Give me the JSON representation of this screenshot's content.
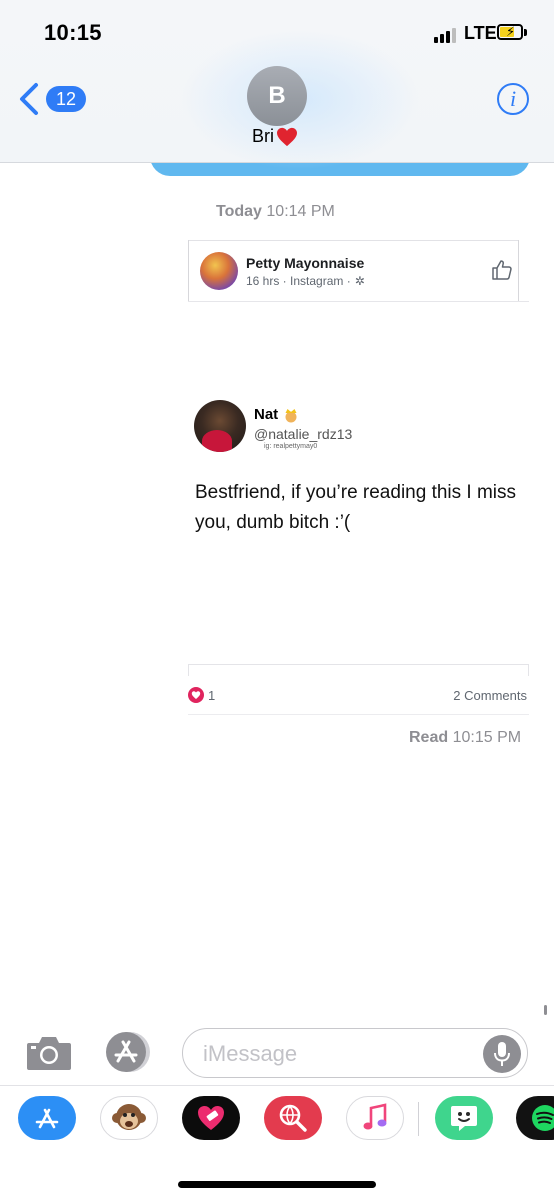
{
  "status_bar": {
    "time": "10:15",
    "network": "LTE"
  },
  "header": {
    "back_badge": "12",
    "avatar_initial": "B",
    "contact_name": "Bri"
  },
  "conversation": {
    "timestamp_day": "Today",
    "timestamp_time": "10:14 PM",
    "shared_post": {
      "page_name": "Petty Mayonnaise",
      "meta": "16 hrs · Instagram ·",
      "tweet_name": "Nat",
      "tweet_handle": "@natalie_rdz13",
      "tweet_watermark": "ig: realpettymay0",
      "tweet_text": "Bestfriend, if you’re reading this I miss you, dumb bitch :’(",
      "reactions_count": "1",
      "comments": "2 Comments"
    },
    "read_label": "Read",
    "read_time": "10:15 PM"
  },
  "input": {
    "placeholder": "iMessage"
  },
  "app_drawer": [
    "app-store-icon",
    "animoji-monkey-icon",
    "heart-app-icon",
    "web-images-search-icon",
    "music-icon",
    "bitmoji-icon",
    "spotify-icon"
  ],
  "colors": {
    "accent": "#2f7cf6",
    "bubble": "#60b8ef",
    "heart": "#e0245e"
  }
}
